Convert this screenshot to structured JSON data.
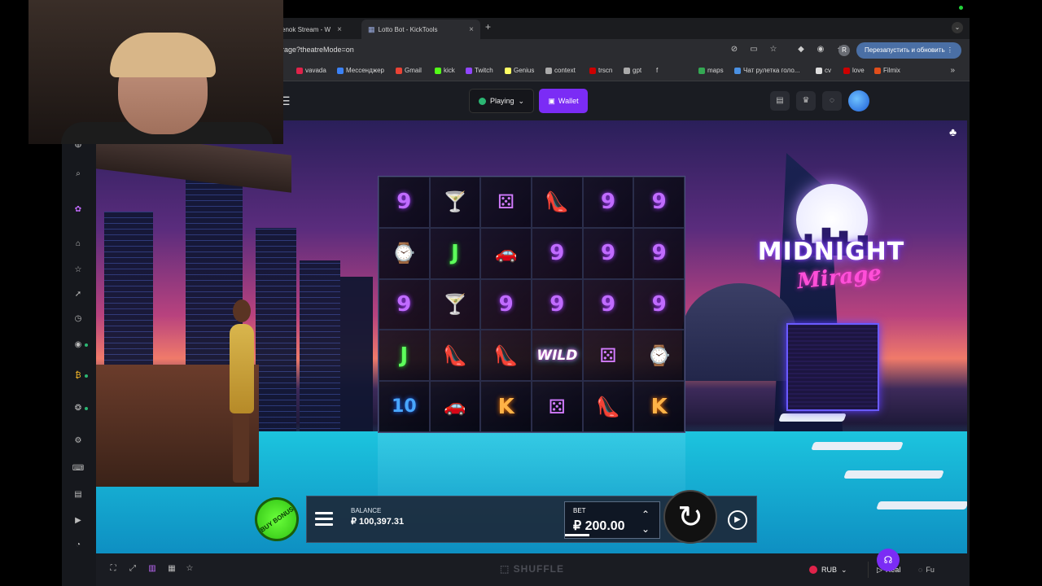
{
  "browser": {
    "tabs": [
      {
        "label": "enok Stream - W"
      },
      {
        "label": "Lotto Bot - KickTools"
      }
    ],
    "url": "irage?theatreMode=on",
    "profile_initial": "R",
    "relaunch_label": "Перезапустить и обновить",
    "bookmarks": [
      {
        "label": "vavada",
        "color": "#e0234a"
      },
      {
        "label": "Мессенджер",
        "color": "#3b82f6"
      },
      {
        "label": "Gmail",
        "color": "#ea4335"
      },
      {
        "label": "kick",
        "color": "#53fc18"
      },
      {
        "label": "Twitch",
        "color": "#9146ff"
      },
      {
        "label": "Genius",
        "color": "#ffff64"
      },
      {
        "label": "context",
        "color": "#aaaaaa"
      },
      {
        "label": "trscn",
        "color": "#cc0000"
      },
      {
        "label": "gpt",
        "color": "#aaaaaa"
      },
      {
        "label": "f",
        "color": "#444444"
      },
      {
        "label": "maps",
        "color": "#34a853"
      },
      {
        "label": "Чат рулетка голо...",
        "color": "#4a90e2"
      },
      {
        "label": "cv",
        "color": "#dddddd"
      },
      {
        "label": "love",
        "color": "#cc0000"
      },
      {
        "label": "Filmix",
        "color": "#e04e1b"
      }
    ]
  },
  "site": {
    "playing_label": "Playing",
    "wallet_label": "Wallet",
    "brand": "SHUFFLE",
    "currency": "RUB",
    "mode_real": "Real",
    "mode_fun": "Fu"
  },
  "game": {
    "title_line1": "MIDNIGHT",
    "title_line2": "Mirage",
    "buy_bonus_label": "BUY BONUS",
    "balance_label": "BALANCE",
    "balance_value": "₽ 100,397.31",
    "bet_label": "BET",
    "bet_value": "₽ 200.00",
    "reels": [
      [
        "9",
        "cocktail",
        "dice",
        "shoe",
        "9",
        "9"
      ],
      [
        "watch",
        "J",
        "car",
        "9",
        "9",
        "9"
      ],
      [
        "9",
        "cocktail",
        "9",
        "9",
        "9",
        "9"
      ],
      [
        "J",
        "shoe",
        "shoe",
        "WILD",
        "dice",
        "watch"
      ],
      [
        "10",
        "car",
        "K",
        "dice",
        "shoe",
        "K"
      ]
    ],
    "accent_colors": {
      "wallet": "#7b2cf5",
      "buy_bonus": "#4cef23",
      "support": "#7b2cf5"
    }
  }
}
